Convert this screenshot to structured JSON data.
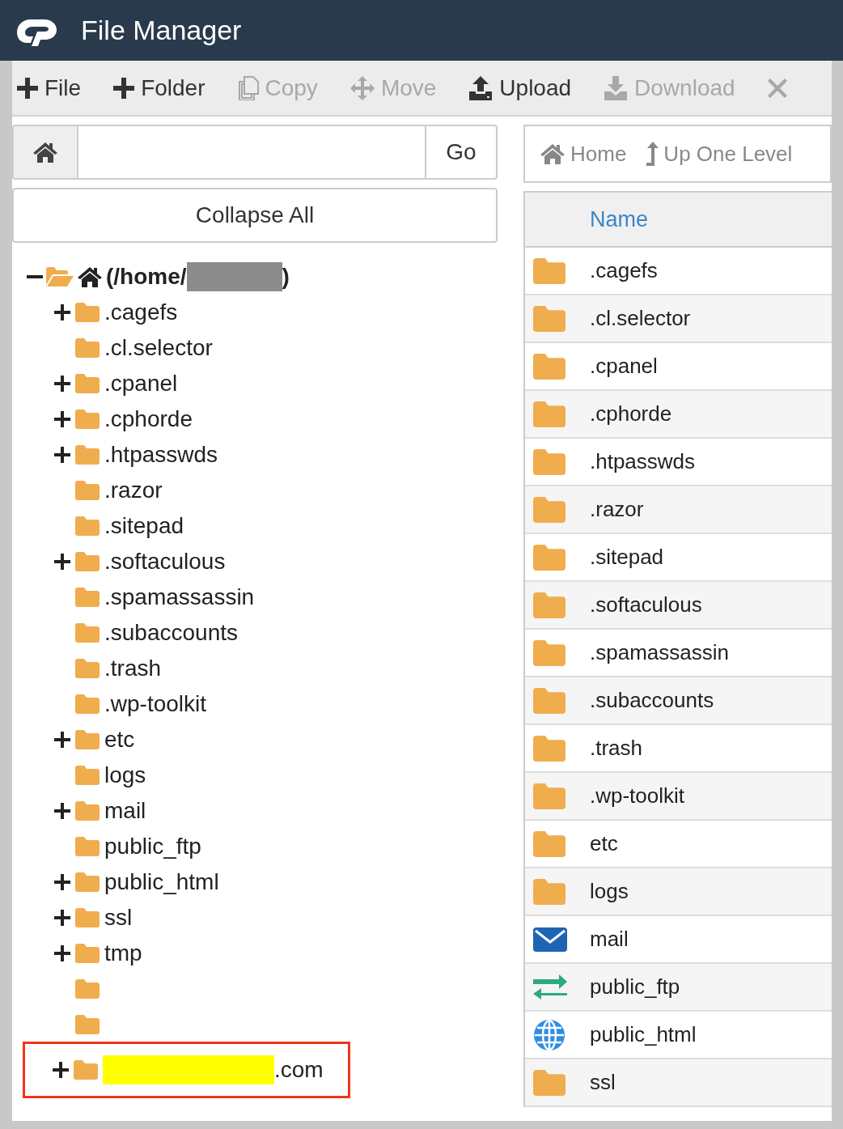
{
  "header": {
    "title": "File Manager"
  },
  "toolbar": [
    {
      "label": "File",
      "kind": "plus",
      "disabled": false
    },
    {
      "label": "Folder",
      "kind": "plus",
      "disabled": false
    },
    {
      "label": "Copy",
      "kind": "copy",
      "disabled": true
    },
    {
      "label": "Move",
      "kind": "move",
      "disabled": true
    },
    {
      "label": "Upload",
      "kind": "upload",
      "disabled": false
    },
    {
      "label": "Download",
      "kind": "download",
      "disabled": true
    },
    {
      "kind": "close",
      "disabled": true
    }
  ],
  "path_bar": {
    "go_button": "Go"
  },
  "collapse_button": "Collapse All",
  "tree": {
    "label_start": "(/home/",
    "label_end": ")",
    "redacted": true,
    "expanded": true,
    "children": [
      {
        "label": ".cagefs",
        "expandable": true
      },
      {
        "label": ".cl.selector",
        "expandable": false
      },
      {
        "label": ".cpanel",
        "expandable": true
      },
      {
        "label": ".cphorde",
        "expandable": true
      },
      {
        "label": ".htpasswds",
        "expandable": true
      },
      {
        "label": ".razor",
        "expandable": false
      },
      {
        "label": ".sitepad",
        "expandable": false
      },
      {
        "label": ".softaculous",
        "expandable": true
      },
      {
        "label": ".spamassassin",
        "expandable": false
      },
      {
        "label": ".subaccounts",
        "expandable": false
      },
      {
        "label": ".trash",
        "expandable": false
      },
      {
        "label": ".wp-toolkit",
        "expandable": false
      },
      {
        "label": "etc",
        "expandable": true
      },
      {
        "label": "logs",
        "expandable": false
      },
      {
        "label": "mail",
        "expandable": true
      },
      {
        "label": "public_ftp",
        "expandable": false
      },
      {
        "label": "public_html",
        "expandable": true
      },
      {
        "label": "ssl",
        "expandable": true
      },
      {
        "label": "tmp",
        "expandable": true
      },
      {
        "expandable": false
      },
      {
        "expandable": false
      },
      {
        "label": ".com",
        "expandable": true,
        "highlighted": true,
        "annotated": true
      }
    ]
  },
  "nav": [
    {
      "label": "Home",
      "kind": "home"
    },
    {
      "label": "Up One Level",
      "kind": "up"
    }
  ],
  "table": {
    "columns": [
      "Name"
    ],
    "rows": [
      {
        "name": ".cagefs",
        "kind": "folder"
      },
      {
        "name": ".cl.selector",
        "kind": "folder"
      },
      {
        "name": ".cpanel",
        "kind": "folder"
      },
      {
        "name": ".cphorde",
        "kind": "folder"
      },
      {
        "name": ".htpasswds",
        "kind": "folder"
      },
      {
        "name": ".razor",
        "kind": "folder"
      },
      {
        "name": ".sitepad",
        "kind": "folder"
      },
      {
        "name": ".softaculous",
        "kind": "folder"
      },
      {
        "name": ".spamassassin",
        "kind": "folder"
      },
      {
        "name": ".subaccounts",
        "kind": "folder"
      },
      {
        "name": ".trash",
        "kind": "folder"
      },
      {
        "name": ".wp-toolkit",
        "kind": "folder"
      },
      {
        "name": "etc",
        "kind": "folder"
      },
      {
        "name": "logs",
        "kind": "folder"
      },
      {
        "name": "mail",
        "kind": "mail"
      },
      {
        "name": "public_ftp",
        "kind": "transfer"
      },
      {
        "name": "public_html",
        "kind": "globe"
      },
      {
        "name": "ssl",
        "kind": "folder"
      }
    ]
  }
}
